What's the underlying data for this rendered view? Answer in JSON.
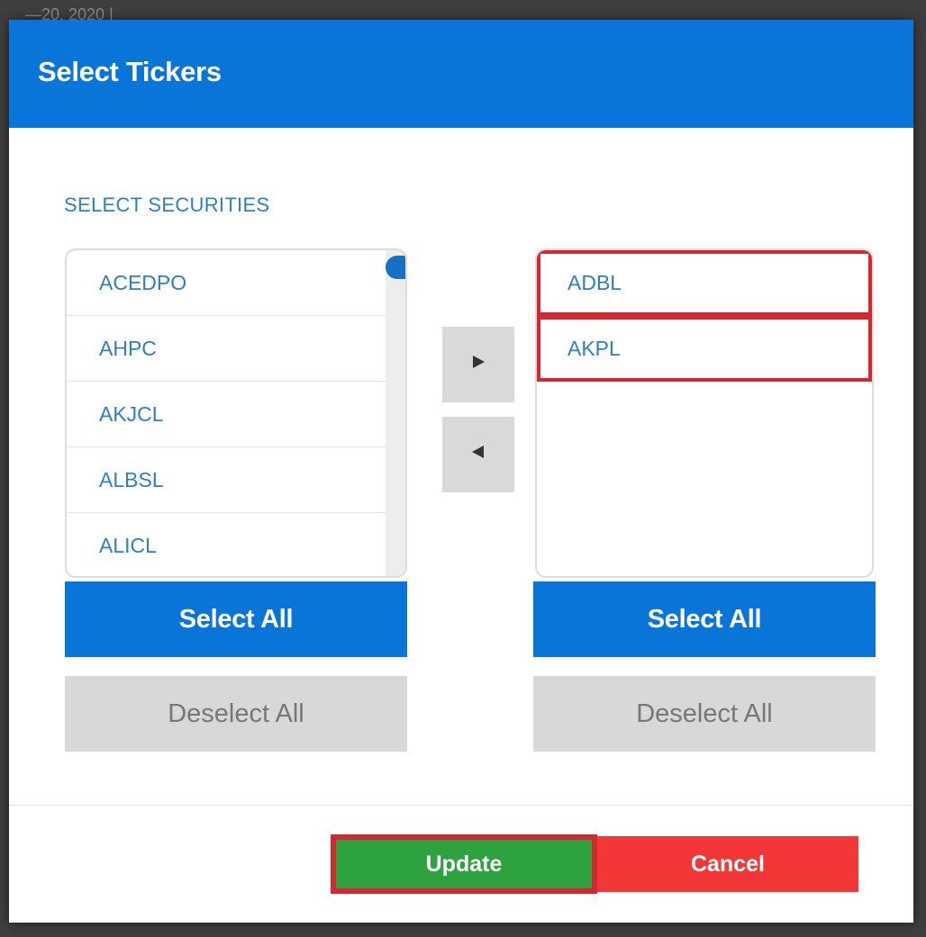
{
  "backdrop": {
    "partial_text": "—20, 2020 |"
  },
  "modal": {
    "title": "Select Tickers",
    "section_label": "SELECT SECURITIES",
    "available_list": {
      "items": [
        "ACEDPO",
        "AHPC",
        "AKJCL",
        "ALBSL",
        "ALICL"
      ]
    },
    "selected_list": {
      "items": [
        "ADBL",
        "AKPL"
      ]
    },
    "move_right_icon": "triangle-right-icon",
    "move_left_icon": "triangle-left-icon",
    "left_buttons": {
      "select_all": "Select All",
      "deselect_all": "Deselect All"
    },
    "right_buttons": {
      "select_all": "Select All",
      "deselect_all": "Deselect All"
    },
    "footer": {
      "update_label": "Update",
      "cancel_label": "Cancel"
    }
  },
  "colors": {
    "header": "#0975d8",
    "link_text": "#2f7fbd",
    "update": "#2ea23e",
    "cancel": "#f33737",
    "highlight_outline": "#d6262f"
  }
}
